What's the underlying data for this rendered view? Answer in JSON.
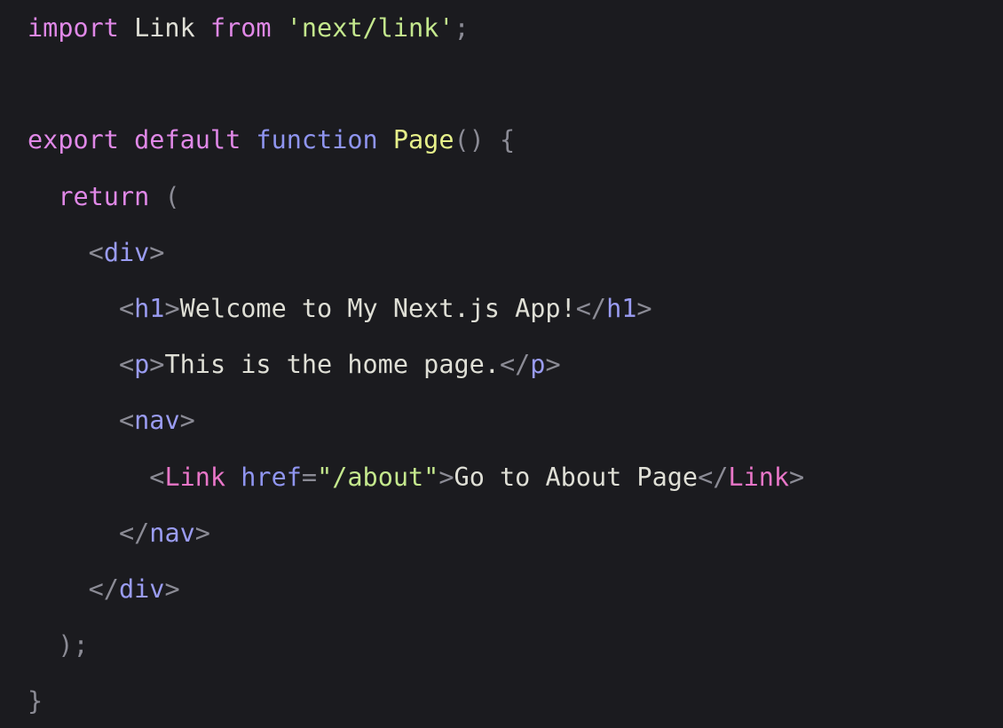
{
  "editor": {
    "background": "#1b1b1f",
    "language": "jsx",
    "lines": [
      {
        "indent": "",
        "tokens": [
          {
            "type": "keyword",
            "text": "import"
          },
          {
            "type": "ident",
            "text": " Link "
          },
          {
            "type": "keyword",
            "text": "from"
          },
          {
            "type": "ident",
            "text": " "
          },
          {
            "type": "string",
            "text": "'next/link'"
          },
          {
            "type": "punct",
            "text": ";"
          }
        ]
      },
      {
        "indent": "",
        "tokens": []
      },
      {
        "indent": "",
        "tokens": [
          {
            "type": "keyword",
            "text": "export"
          },
          {
            "type": "ident",
            "text": " "
          },
          {
            "type": "keyword",
            "text": "default"
          },
          {
            "type": "ident",
            "text": " "
          },
          {
            "type": "decl",
            "text": "function"
          },
          {
            "type": "ident",
            "text": " "
          },
          {
            "type": "func",
            "text": "Page"
          },
          {
            "type": "punct",
            "text": "() {"
          }
        ]
      },
      {
        "indent": "  ",
        "tokens": [
          {
            "type": "keyword",
            "text": "return"
          },
          {
            "type": "punct",
            "text": " ("
          }
        ]
      },
      {
        "indent": "    ",
        "tokens": [
          {
            "type": "punct",
            "text": "<"
          },
          {
            "type": "tag",
            "text": "div"
          },
          {
            "type": "punct",
            "text": ">"
          }
        ]
      },
      {
        "indent": "      ",
        "tokens": [
          {
            "type": "punct",
            "text": "<"
          },
          {
            "type": "tag",
            "text": "h1"
          },
          {
            "type": "punct",
            "text": ">"
          },
          {
            "type": "text",
            "text": "Welcome to My Next.js App!"
          },
          {
            "type": "punct",
            "text": "</"
          },
          {
            "type": "tag",
            "text": "h1"
          },
          {
            "type": "punct",
            "text": ">"
          }
        ]
      },
      {
        "indent": "      ",
        "tokens": [
          {
            "type": "punct",
            "text": "<"
          },
          {
            "type": "tag",
            "text": "p"
          },
          {
            "type": "punct",
            "text": ">"
          },
          {
            "type": "text",
            "text": "This is the home page."
          },
          {
            "type": "punct",
            "text": "</"
          },
          {
            "type": "tag",
            "text": "p"
          },
          {
            "type": "punct",
            "text": ">"
          }
        ]
      },
      {
        "indent": "      ",
        "tokens": [
          {
            "type": "punct",
            "text": "<"
          },
          {
            "type": "tag",
            "text": "nav"
          },
          {
            "type": "punct",
            "text": ">"
          }
        ]
      },
      {
        "indent": "        ",
        "tokens": [
          {
            "type": "punct",
            "text": "<"
          },
          {
            "type": "comp",
            "text": "Link"
          },
          {
            "type": "ident",
            "text": " "
          },
          {
            "type": "attr",
            "text": "href"
          },
          {
            "type": "punct",
            "text": "="
          },
          {
            "type": "string",
            "text": "\"/about\""
          },
          {
            "type": "punct",
            "text": ">"
          },
          {
            "type": "text",
            "text": "Go to About Page"
          },
          {
            "type": "punct",
            "text": "</"
          },
          {
            "type": "comp",
            "text": "Link"
          },
          {
            "type": "punct",
            "text": ">"
          }
        ]
      },
      {
        "indent": "      ",
        "tokens": [
          {
            "type": "punct",
            "text": "</"
          },
          {
            "type": "tag",
            "text": "nav"
          },
          {
            "type": "punct",
            "text": ">"
          }
        ]
      },
      {
        "indent": "    ",
        "tokens": [
          {
            "type": "punct",
            "text": "</"
          },
          {
            "type": "tag",
            "text": "div"
          },
          {
            "type": "punct",
            "text": ">"
          }
        ]
      },
      {
        "indent": "  ",
        "tokens": [
          {
            "type": "punct",
            "text": ");"
          }
        ]
      },
      {
        "indent": "",
        "tokens": [
          {
            "type": "punct",
            "text": "}"
          }
        ]
      }
    ]
  }
}
